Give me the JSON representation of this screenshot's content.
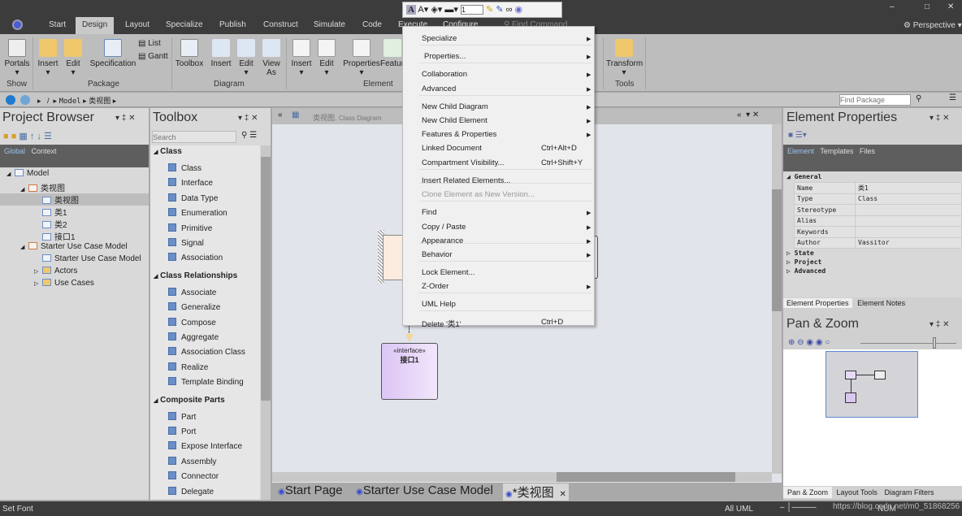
{
  "ribbon_tabs": [
    "Start",
    "Design",
    "Layout",
    "Specialize",
    "Publish",
    "Construct",
    "Simulate",
    "Code",
    "Execute",
    "Configure"
  ],
  "active_tab": "Design",
  "find_command": "Find Command",
  "perspective": "Perspective",
  "ribbon": {
    "show": {
      "portals": "Portals",
      "group": "Show"
    },
    "package": {
      "insert": "Insert",
      "edit": "Edit",
      "specification": "Specification",
      "list": "List",
      "gantt": "Gantt",
      "group": "Package"
    },
    "diagram": {
      "toolbox": "Toolbox",
      "insert": "Insert",
      "edit": "Edit",
      "view_as": "View As",
      "group": "Diagram"
    },
    "element": {
      "insert": "Insert",
      "edit": "Edit",
      "properties": "Properties",
      "features": "Features",
      "group": "Element"
    },
    "tools": {
      "transform": "Transform",
      "group": "Tools"
    }
  },
  "float_toolbar": {
    "line_width": "1"
  },
  "breadcrumb": [
    "/",
    "Model",
    "类视图"
  ],
  "find_package_placeholder": "Find Package",
  "project_browser": {
    "title": "Project Browser",
    "tabs": [
      "Global",
      "Context"
    ],
    "tree": [
      {
        "label": "Model",
        "level": 0,
        "expanded": true
      },
      {
        "label": "类视图",
        "level": 1,
        "expanded": true
      },
      {
        "label": "类视图",
        "level": 2,
        "selected": true
      },
      {
        "label": "类1",
        "level": 2
      },
      {
        "label": "类2",
        "level": 2
      },
      {
        "label": "接口1",
        "level": 2
      },
      {
        "label": "Starter Use Case Model",
        "level": 1,
        "expanded": true
      },
      {
        "label": "Starter Use Case Model",
        "level": 2
      },
      {
        "label": "Actors",
        "level": 2,
        "collapsed": true
      },
      {
        "label": "Use Cases",
        "level": 2,
        "collapsed": true
      }
    ]
  },
  "toolbox": {
    "title": "Toolbox",
    "search_placeholder": "Search",
    "groups": [
      {
        "name": "Class",
        "items": [
          "Class",
          "Interface",
          "Data Type",
          "Enumeration",
          "Primitive",
          "Signal",
          "Association"
        ]
      },
      {
        "name": "Class Relationships",
        "items": [
          "Associate",
          "Generalize",
          "Compose",
          "Aggregate",
          "Association Class",
          "Realize",
          "Template Binding"
        ]
      },
      {
        "name": "Composite Parts",
        "items": [
          "Part",
          "Port",
          "Expose Interface",
          "Assembly",
          "Connector",
          "Delegate"
        ]
      }
    ]
  },
  "diagram": {
    "name": "类视图.",
    "type": "Class Diagram",
    "interface": {
      "stereotype": "«interface»",
      "name": "接口1"
    }
  },
  "doc_tabs": [
    {
      "label": "Start Page"
    },
    {
      "label": "Starter Use Case Model"
    },
    {
      "label": "*类视图",
      "active": true
    }
  ],
  "context_menu": [
    {
      "label": "Specialize",
      "submenu": true
    },
    {
      "label": "Properties...",
      "submenu": true
    },
    {
      "label": "Collaboration",
      "submenu": true
    },
    {
      "label": "Advanced",
      "submenu": true
    },
    {
      "label": "New Child Diagram",
      "submenu": true
    },
    {
      "label": "New Child Element",
      "submenu": true
    },
    {
      "label": "Features & Properties",
      "submenu": true
    },
    {
      "label": "Linked Document",
      "shortcut": "Ctrl+Alt+D"
    },
    {
      "label": "Compartment Visibility...",
      "shortcut": "Ctrl+Shift+Y"
    },
    {
      "label": "Insert Related Elements..."
    },
    {
      "label": "Clone Element as New Version...",
      "disabled": true
    },
    {
      "label": "Find",
      "submenu": true
    },
    {
      "label": "Copy / Paste",
      "submenu": true
    },
    {
      "label": "Appearance",
      "submenu": true
    },
    {
      "label": "Behavior",
      "submenu": true
    },
    {
      "label": "Lock Element..."
    },
    {
      "label": "Z-Order",
      "submenu": true
    },
    {
      "label": "UML Help"
    },
    {
      "label": "Delete '类1'",
      "shortcut": "Ctrl+D"
    }
  ],
  "element_properties": {
    "title": "Element Properties",
    "tabs": [
      "Element",
      "Templates",
      "Files"
    ],
    "sections": [
      "General",
      "State",
      "Project",
      "Advanced"
    ],
    "general": [
      [
        "Name",
        "类1"
      ],
      [
        "Type",
        "Class"
      ],
      [
        "Stereotype",
        ""
      ],
      [
        "Alias",
        ""
      ],
      [
        "Keywords",
        ""
      ],
      [
        "Author",
        "Vassitor"
      ]
    ],
    "bottom_tabs": [
      "Element Properties",
      "Element Notes"
    ]
  },
  "pan_zoom": {
    "title": "Pan & Zoom",
    "bottom_tabs": [
      "Pan & Zoom",
      "Layout Tools",
      "Diagram Filters"
    ]
  },
  "status": {
    "left": "Set Font",
    "mode": "All UML",
    "num": "NUM",
    "watermark": "https://blog.csdn.net/m0_51868256"
  }
}
